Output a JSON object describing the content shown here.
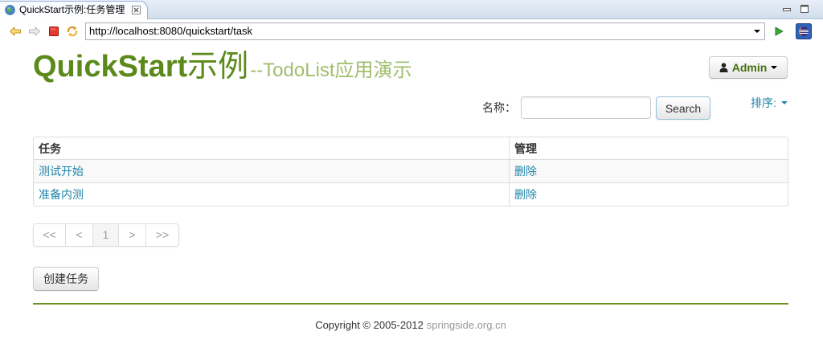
{
  "browser": {
    "tab": {
      "title": "QuickStart示例:任务管理",
      "icons": [
        "globe-icon",
        "close-icon"
      ]
    },
    "window_controls": [
      "minimize-icon",
      "maximize-icon"
    ],
    "toolbar": {
      "icons": [
        "back-icon",
        "forward-icon",
        "stop-icon",
        "refresh-icon",
        "chevron-down-icon",
        "go-icon",
        "eclipse-icon"
      ],
      "url": "http://localhost:8080/quickstart/task"
    }
  },
  "header": {
    "brand": "QuickStart",
    "brand_suffix": "示例",
    "subtitle": "--TodoList应用演示",
    "user_menu": {
      "label": "Admin",
      "icons": [
        "user-icon",
        "caret-down-icon"
      ]
    }
  },
  "search": {
    "label": "名称：",
    "value": "",
    "button": "Search",
    "sort": {
      "label": "排序:",
      "icon": "caret-down-icon"
    }
  },
  "table": {
    "headers": [
      "任务",
      "管理"
    ],
    "rows": [
      {
        "task": "测试开始",
        "action": "删除"
      },
      {
        "task": "准备内测",
        "action": "删除"
      }
    ]
  },
  "pagination": {
    "items": [
      {
        "label": "<<",
        "disabled": true
      },
      {
        "label": "<",
        "disabled": true
      },
      {
        "label": "1",
        "active": true
      },
      {
        "label": ">",
        "disabled": true
      },
      {
        "label": ">>",
        "disabled": true
      }
    ]
  },
  "actions": {
    "create_task": "创建任务"
  },
  "footer": {
    "copyright": "Copyright © 2005-2012",
    "link": "springside.org.cn"
  },
  "theme": {
    "brand": "#5b8a1a",
    "subtitle": "#a2bd6c",
    "link": "#2185a8",
    "footer_rule": "#6f9025",
    "user_label": "#446f12",
    "muted": "#999999"
  }
}
